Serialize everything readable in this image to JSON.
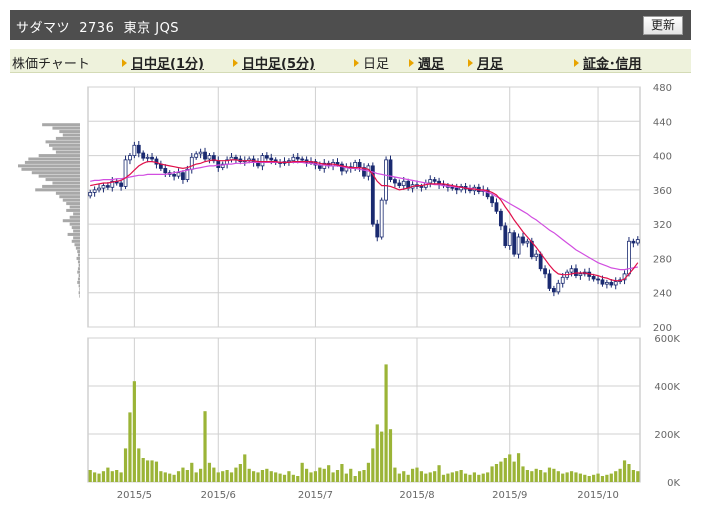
{
  "header": {
    "title": "サダマツ  2736  東京 JQS",
    "refresh_label": "更新"
  },
  "tabs": {
    "label": "株価チャート",
    "items": [
      {
        "label": "日中足(1分)",
        "active": false
      },
      {
        "label": "日中足(5分)",
        "active": false
      },
      {
        "label": "日足",
        "active": true
      },
      {
        "label": "週足",
        "active": false
      },
      {
        "label": "月足",
        "active": false
      },
      {
        "label": "証金･信用",
        "active": false
      }
    ]
  },
  "colors": {
    "up": "#3a4ea0",
    "down": "#1a2a70",
    "ma_short": "#e0104a",
    "ma_long": "#d14ee0",
    "volume": "#9bb437",
    "profile": "#a8a8a8",
    "grid": "#d0d0d0"
  },
  "chart_data": [
    {
      "type": "candlestick",
      "name": "price",
      "ylim": [
        200,
        480
      ],
      "yticks": [
        200,
        240,
        280,
        320,
        360,
        400,
        440,
        480
      ],
      "ytick_labels": [
        "200",
        "240",
        "280",
        "320",
        "360",
        "400",
        "440",
        "480"
      ],
      "x_month_labels": [
        {
          "label": "2015/5",
          "day_index": 10
        },
        {
          "label": "2015/6",
          "day_index": 29
        },
        {
          "label": "2015/7",
          "day_index": 51
        },
        {
          "label": "2015/8",
          "day_index": 74
        },
        {
          "label": "2015/9",
          "day_index": 95
        },
        {
          "label": "2015/10",
          "day_index": 115
        }
      ],
      "days": 125,
      "close": [
        357,
        360,
        362,
        365,
        363,
        370,
        368,
        364,
        395,
        400,
        412,
        403,
        397,
        398,
        396,
        390,
        385,
        380,
        378,
        376,
        380,
        372,
        384,
        398,
        402,
        404,
        396,
        400,
        394,
        386,
        390,
        395,
        398,
        396,
        393,
        394,
        396,
        392,
        388,
        400,
        397,
        395,
        392,
        391,
        393,
        394,
        398,
        396,
        395,
        392,
        393,
        389,
        385,
        391,
        388,
        392,
        390,
        382,
        387,
        385,
        392,
        386,
        376,
        388,
        320,
        305,
        348,
        395,
        372,
        368,
        365,
        370,
        362,
        366,
        364,
        363,
        368,
        372,
        370,
        366,
        365,
        363,
        362,
        360,
        364,
        361,
        359,
        363,
        358,
        360,
        352,
        345,
        335,
        318,
        295,
        310,
        285,
        305,
        298,
        300,
        282,
        285,
        268,
        262,
        245,
        241,
        251,
        258,
        264,
        268,
        260,
        262,
        264,
        259,
        256,
        255,
        250,
        252,
        249,
        253,
        255,
        262,
        300,
        298,
        302
      ],
      "ma_short": [
        365,
        366,
        367,
        368,
        368,
        369,
        370,
        371,
        374,
        378,
        383,
        388,
        391,
        393,
        393,
        392,
        390,
        389,
        388,
        387,
        386,
        385,
        386,
        388,
        390,
        391,
        393,
        394,
        395,
        394,
        394,
        394,
        395,
        395,
        394,
        394,
        394,
        394,
        393,
        393,
        393,
        393,
        393,
        392,
        392,
        392,
        393,
        393,
        393,
        393,
        393,
        392,
        391,
        390,
        390,
        390,
        389,
        388,
        387,
        386,
        386,
        386,
        385,
        384,
        378,
        370,
        365,
        365,
        364,
        362,
        360,
        361,
        362,
        364,
        365,
        365,
        366,
        367,
        367,
        367,
        367,
        366,
        365,
        364,
        363,
        362,
        361,
        361,
        360,
        360,
        359,
        357,
        354,
        348,
        340,
        333,
        325,
        318,
        311,
        305,
        299,
        293,
        286,
        279,
        272,
        266,
        262,
        261,
        261,
        262,
        263,
        263,
        263,
        262,
        261,
        260,
        258,
        257,
        255,
        254,
        254,
        256,
        262,
        268,
        275
      ],
      "ma_long": [
        370,
        371,
        371,
        372,
        372,
        372,
        373,
        373,
        374,
        375,
        376,
        377,
        377,
        378,
        378,
        378,
        378,
        378,
        379,
        380,
        381,
        382,
        383,
        384,
        385,
        386,
        387,
        388,
        388,
        389,
        389,
        390,
        390,
        391,
        391,
        391,
        392,
        392,
        392,
        392,
        392,
        392,
        392,
        392,
        392,
        392,
        392,
        392,
        392,
        391,
        391,
        390,
        389,
        389,
        388,
        388,
        388,
        387,
        386,
        385,
        385,
        384,
        383,
        382,
        381,
        379,
        378,
        377,
        376,
        375,
        374,
        373,
        372,
        371,
        370,
        369,
        368,
        367,
        366,
        366,
        365,
        364,
        364,
        363,
        363,
        362,
        362,
        361,
        360,
        359,
        357,
        355,
        352,
        350,
        347,
        344,
        341,
        338,
        335,
        332,
        328,
        325,
        321,
        317,
        313,
        310,
        306,
        302,
        298,
        294,
        290,
        287,
        284,
        281,
        278,
        275,
        273,
        271,
        269,
        268,
        267,
        267,
        268,
        269,
        270
      ]
    },
    {
      "type": "bar",
      "name": "volume",
      "ylim": [
        0,
        600000
      ],
      "yticks": [
        0,
        200000,
        400000,
        600000
      ],
      "ytick_labels": [
        "0K",
        "200K",
        "400K",
        "600K"
      ],
      "values": [
        50000,
        40000,
        35000,
        45000,
        60000,
        45000,
        50000,
        40000,
        140000,
        290000,
        420000,
        140000,
        100000,
        90000,
        90000,
        85000,
        45000,
        40000,
        35000,
        30000,
        45000,
        60000,
        50000,
        80000,
        40000,
        55000,
        295000,
        80000,
        60000,
        40000,
        45000,
        50000,
        40000,
        60000,
        75000,
        115000,
        55000,
        45000,
        40000,
        50000,
        55000,
        45000,
        40000,
        35000,
        30000,
        45000,
        30000,
        25000,
        80000,
        55000,
        40000,
        45000,
        60000,
        55000,
        70000,
        40000,
        50000,
        75000,
        35000,
        55000,
        25000,
        45000,
        50000,
        80000,
        140000,
        240000,
        210000,
        490000,
        220000,
        60000,
        35000,
        45000,
        30000,
        55000,
        60000,
        45000,
        35000,
        40000,
        45000,
        70000,
        30000,
        35000,
        40000,
        45000,
        50000,
        35000,
        30000,
        40000,
        30000,
        35000,
        40000,
        65000,
        75000,
        85000,
        100000,
        115000,
        85000,
        120000,
        65000,
        50000,
        45000,
        55000,
        50000,
        40000,
        60000,
        55000,
        45000,
        35000,
        40000,
        45000,
        40000,
        35000,
        30000,
        25000,
        30000,
        35000,
        25000,
        30000,
        35000,
        45000,
        55000,
        90000,
        75000,
        50000,
        45000
      ]
    },
    {
      "type": "bar",
      "name": "price-volume-profile",
      "orientation": "horizontal",
      "price_levels": [
        436,
        432,
        428,
        424,
        420,
        416,
        412,
        408,
        404,
        400,
        396,
        392,
        388,
        384,
        380,
        376,
        372,
        368,
        364,
        360,
        356,
        352,
        348,
        344,
        340,
        336,
        332,
        328,
        324,
        320,
        316,
        312,
        308,
        304,
        300,
        296,
        292,
        288,
        284,
        280,
        276,
        272,
        268,
        264,
        260,
        256,
        252,
        248,
        244,
        240,
        236
      ],
      "values": [
        55,
        40,
        30,
        25,
        35,
        50,
        45,
        40,
        35,
        60,
        75,
        80,
        90,
        85,
        70,
        60,
        50,
        40,
        55,
        65,
        35,
        30,
        25,
        20,
        15,
        20,
        10,
        15,
        25,
        15,
        12,
        10,
        18,
        10,
        12,
        8,
        6,
        4,
        3,
        5,
        3,
        2,
        3,
        4,
        2,
        3,
        4,
        2,
        1,
        2,
        1
      ]
    }
  ]
}
